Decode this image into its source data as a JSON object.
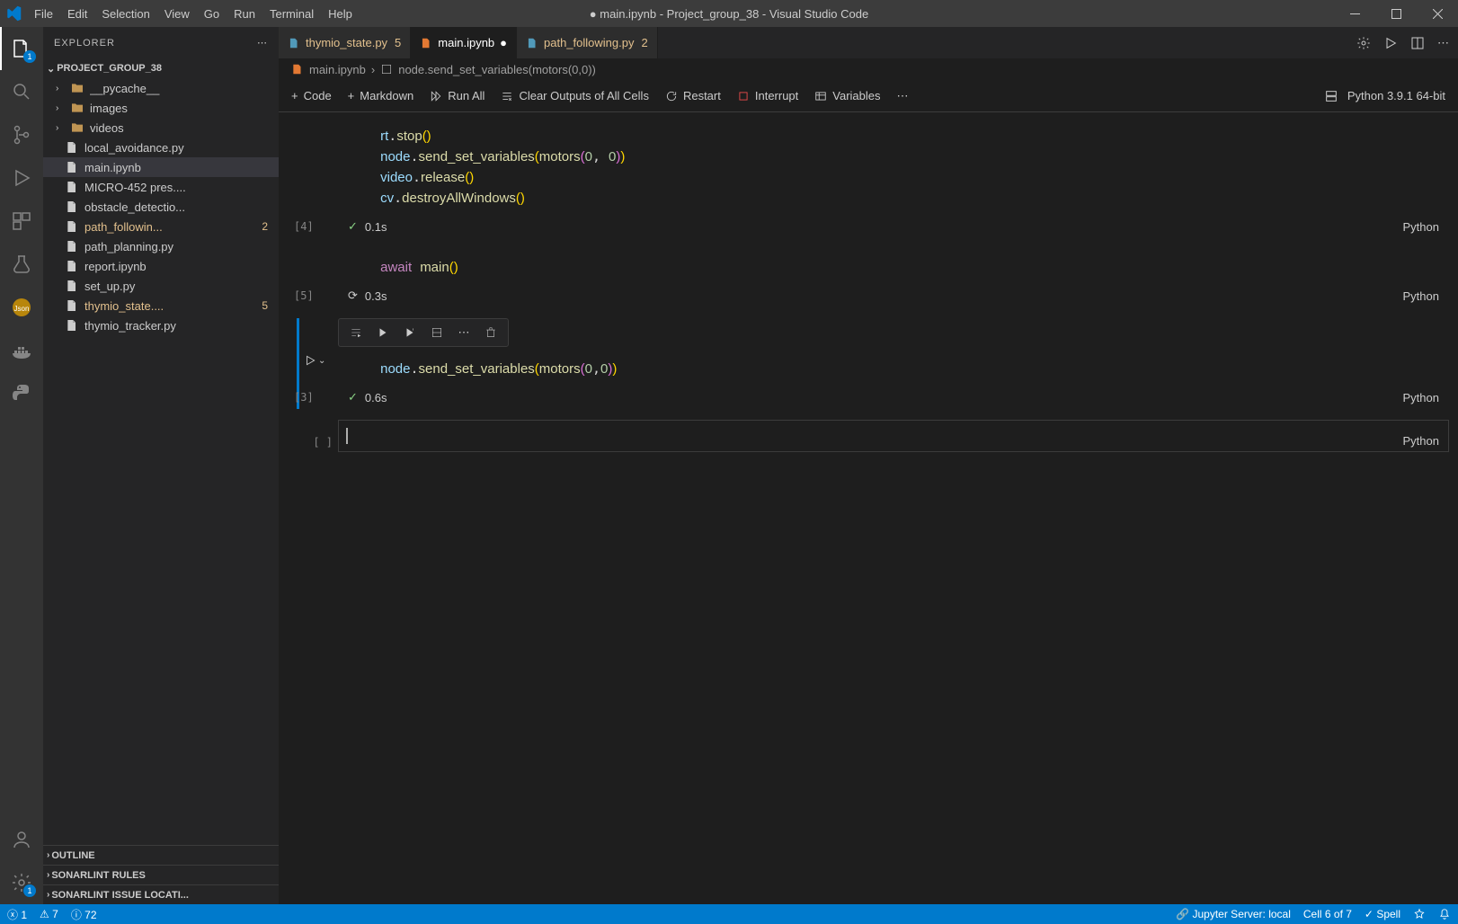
{
  "title": "● main.ipynb - Project_group_38 - Visual Studio Code",
  "menu": [
    "File",
    "Edit",
    "Selection",
    "View",
    "Go",
    "Run",
    "Terminal",
    "Help"
  ],
  "activity_badge": "1",
  "settings_badge": "1",
  "sidebar": {
    "title": "EXPLORER",
    "project": "PROJECT_GROUP_38",
    "items": [
      {
        "type": "folder",
        "name": "__pycache__"
      },
      {
        "type": "folder",
        "name": "images"
      },
      {
        "type": "folder",
        "name": "videos"
      },
      {
        "type": "file",
        "name": "local_avoidance.py"
      },
      {
        "type": "file",
        "name": "main.ipynb",
        "active": true
      },
      {
        "type": "file",
        "name": "MICRO-452 pres...."
      },
      {
        "type": "file",
        "name": "obstacle_detectio..."
      },
      {
        "type": "file",
        "name": "path_followin...",
        "modified": true,
        "count": "2"
      },
      {
        "type": "file",
        "name": "path_planning.py"
      },
      {
        "type": "file",
        "name": "report.ipynb"
      },
      {
        "type": "file",
        "name": "set_up.py"
      },
      {
        "type": "file",
        "name": "thymio_state....",
        "modified": true,
        "count": "5"
      },
      {
        "type": "file",
        "name": "thymio_tracker.py"
      }
    ],
    "sections": [
      "OUTLINE",
      "SONARLINT RULES",
      "SONARLINT ISSUE LOCATI..."
    ]
  },
  "tabs": [
    {
      "name": "thymio_state.py",
      "badge": "5",
      "modified": true
    },
    {
      "name": "main.ipynb",
      "active": true,
      "dirty": true
    },
    {
      "name": "path_following.py",
      "badge": "2",
      "modified": true
    }
  ],
  "breadcrumb": {
    "file": "main.ipynb",
    "symbol": "node.send_set_variables(motors(0,0))"
  },
  "toolbar": {
    "code": "Code",
    "markdown": "Markdown",
    "run_all": "Run All",
    "clear": "Clear Outputs of All Cells",
    "restart": "Restart",
    "interrupt": "Interrupt",
    "variables": "Variables",
    "kernel": "Python 3.9.1 64-bit"
  },
  "cells": [
    {
      "exec": "[4]",
      "status": "done",
      "time": "0.1s",
      "lang": "Python",
      "code_lines": [
        {
          "tokens": [
            {
              "t": "var",
              "v": "rt"
            },
            {
              "t": "",
              "v": "."
            },
            {
              "t": "fn",
              "v": "stop"
            },
            {
              "t": "br1",
              "v": "()"
            }
          ]
        },
        {
          "tokens": [
            {
              "t": "var",
              "v": "node"
            },
            {
              "t": "",
              "v": "."
            },
            {
              "t": "fn",
              "v": "send_set_variables"
            },
            {
              "t": "br1",
              "v": "("
            },
            {
              "t": "fn",
              "v": "motors"
            },
            {
              "t": "br2",
              "v": "("
            },
            {
              "t": "num",
              "v": "0"
            },
            {
              "t": "",
              "v": ", "
            },
            {
              "t": "num",
              "v": "0"
            },
            {
              "t": "br2",
              "v": ")"
            },
            {
              "t": "br1",
              "v": ")"
            }
          ]
        },
        {
          "tokens": [
            {
              "t": "var",
              "v": "video"
            },
            {
              "t": "",
              "v": "."
            },
            {
              "t": "fn",
              "v": "release"
            },
            {
              "t": "br1",
              "v": "()"
            }
          ]
        },
        {
          "tokens": [
            {
              "t": "var",
              "v": "cv"
            },
            {
              "t": "",
              "v": "."
            },
            {
              "t": "fn",
              "v": "destroyAllWindows"
            },
            {
              "t": "br1",
              "v": "()"
            }
          ]
        }
      ]
    },
    {
      "exec": "[5]",
      "status": "running",
      "time": "0.3s",
      "lang": "Python",
      "code_lines": [
        {
          "tokens": [
            {
              "t": "kw",
              "v": "await"
            },
            {
              "t": "",
              "v": " "
            },
            {
              "t": "fn",
              "v": "main"
            },
            {
              "t": "br1",
              "v": "()"
            }
          ]
        }
      ]
    },
    {
      "exec": "[3]",
      "status": "done",
      "time": "0.6s",
      "lang": "Python",
      "focused": true,
      "has_toolbar": true,
      "code_lines": [
        {
          "tokens": [
            {
              "t": "var",
              "v": "node"
            },
            {
              "t": "",
              "v": "."
            },
            {
              "t": "fn",
              "v": "send_set_variables"
            },
            {
              "t": "br1",
              "v": "("
            },
            {
              "t": "fn",
              "v": "motors"
            },
            {
              "t": "br2",
              "v": "("
            },
            {
              "t": "num",
              "v": "0"
            },
            {
              "t": "",
              "v": ","
            },
            {
              "t": "num",
              "v": "0"
            },
            {
              "t": "br2",
              "v": ")"
            },
            {
              "t": "br1",
              "v": ")"
            }
          ]
        }
      ]
    },
    {
      "exec": "[ ]",
      "status": "none",
      "lang": "Python",
      "empty": true
    }
  ],
  "status": {
    "errors": "1",
    "warnings": "7",
    "info": "72",
    "jupyter": "Jupyter Server: local",
    "cell": "Cell 6 of 7",
    "spell": "Spell"
  }
}
